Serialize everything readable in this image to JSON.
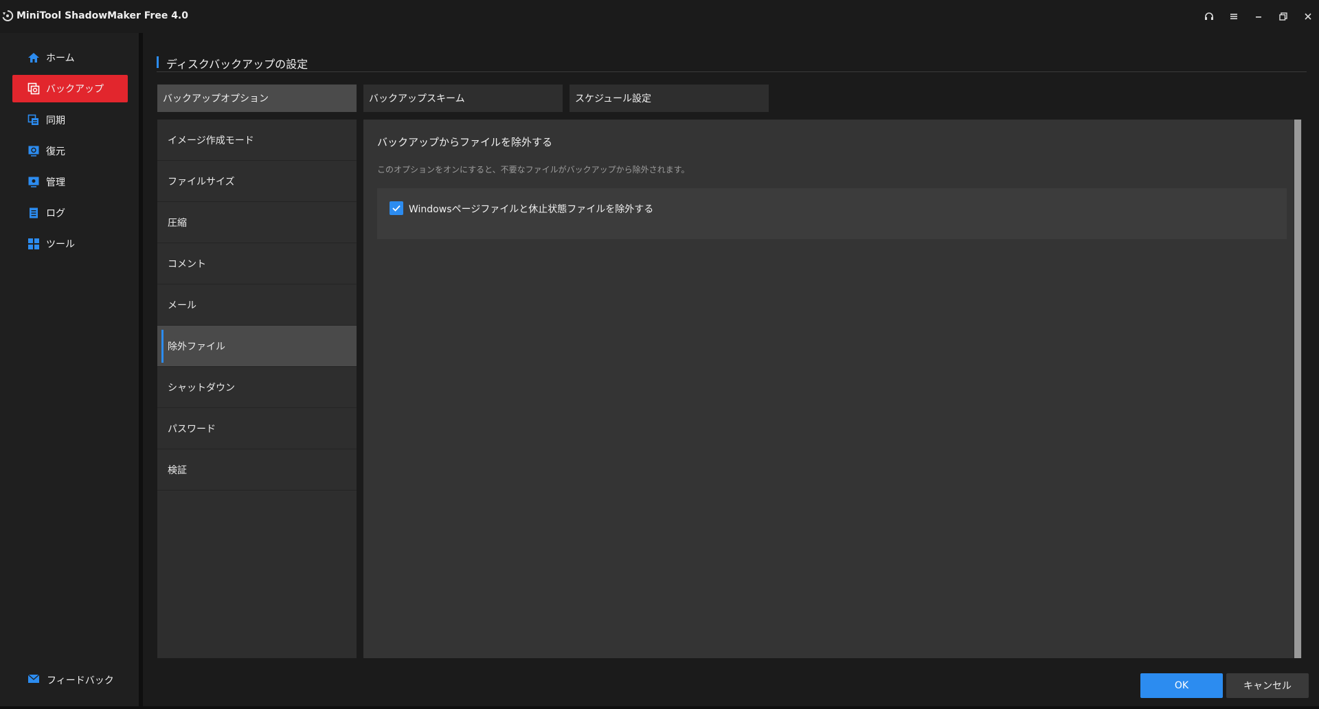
{
  "app": {
    "title": "MiniTool ShadowMaker Free 4.0",
    "controls": [
      "headset-icon",
      "menu-icon",
      "minimize-icon",
      "restore-icon",
      "close-icon"
    ]
  },
  "sidebar": {
    "items": [
      {
        "label": "ホーム",
        "icon": "home-icon",
        "active": false
      },
      {
        "label": "バックアップ",
        "icon": "backup-icon",
        "active": true
      },
      {
        "label": "同期",
        "icon": "sync-icon",
        "active": false
      },
      {
        "label": "復元",
        "icon": "restore-icon",
        "active": false
      },
      {
        "label": "管理",
        "icon": "manage-icon",
        "active": false
      },
      {
        "label": "ログ",
        "icon": "log-icon",
        "active": false
      },
      {
        "label": "ツール",
        "icon": "tools-icon",
        "active": false
      }
    ],
    "feedback_label": "フィードバック"
  },
  "page": {
    "title": "ディスクバックアップの設定",
    "tabs": [
      {
        "label": "バックアップオプション",
        "active": true
      },
      {
        "label": "バックアップスキーム",
        "active": false
      },
      {
        "label": "スケジュール設定",
        "active": false
      }
    ],
    "options": [
      {
        "label": "イメージ作成モード",
        "active": false
      },
      {
        "label": "ファイルサイズ",
        "active": false
      },
      {
        "label": "圧縮",
        "active": false
      },
      {
        "label": "コメント",
        "active": false
      },
      {
        "label": "メール",
        "active": false
      },
      {
        "label": "除外ファイル",
        "active": true
      },
      {
        "label": "シャットダウン",
        "active": false
      },
      {
        "label": "パスワード",
        "active": false
      },
      {
        "label": "検証",
        "active": false
      }
    ],
    "panel": {
      "title": "バックアップからファイルを除外する",
      "description": "このオプションをオンにすると、不要なファイルがバックアップから除外されます。",
      "checkbox_label": "Windowsページファイルと休止状態ファイルを除外する",
      "checkbox_checked": true
    },
    "buttons": {
      "ok": "OK",
      "cancel": "キャンセル"
    }
  },
  "colors": {
    "accent": "#2c8cf0",
    "active_nav": "#e2262d"
  }
}
